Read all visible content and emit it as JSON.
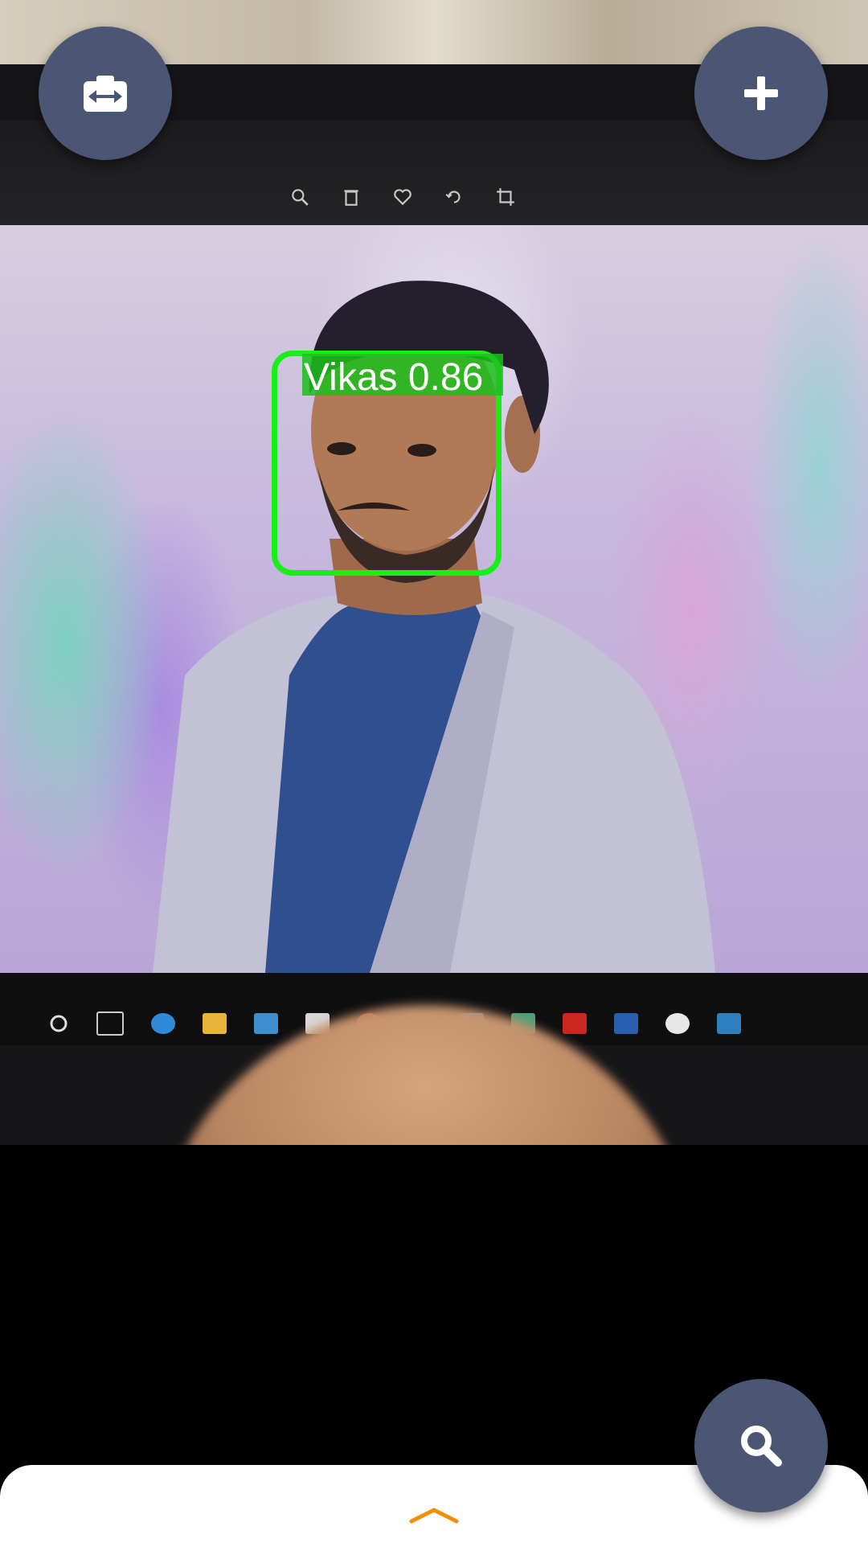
{
  "detection": {
    "label": "Vikas 0.86",
    "box_color": "#19ee19"
  },
  "buttons": {
    "switch_camera": {
      "icon": "switch-camera-icon"
    },
    "add": {
      "icon": "plus-icon"
    },
    "search": {
      "icon": "search-icon"
    }
  },
  "sheet": {
    "handle_icon": "chevron-up-icon",
    "handle_color": "#f0900a"
  },
  "colors": {
    "fab_background": "#4a5673",
    "fab_icon": "#ffffff",
    "sheet_background": "#ffffff"
  }
}
